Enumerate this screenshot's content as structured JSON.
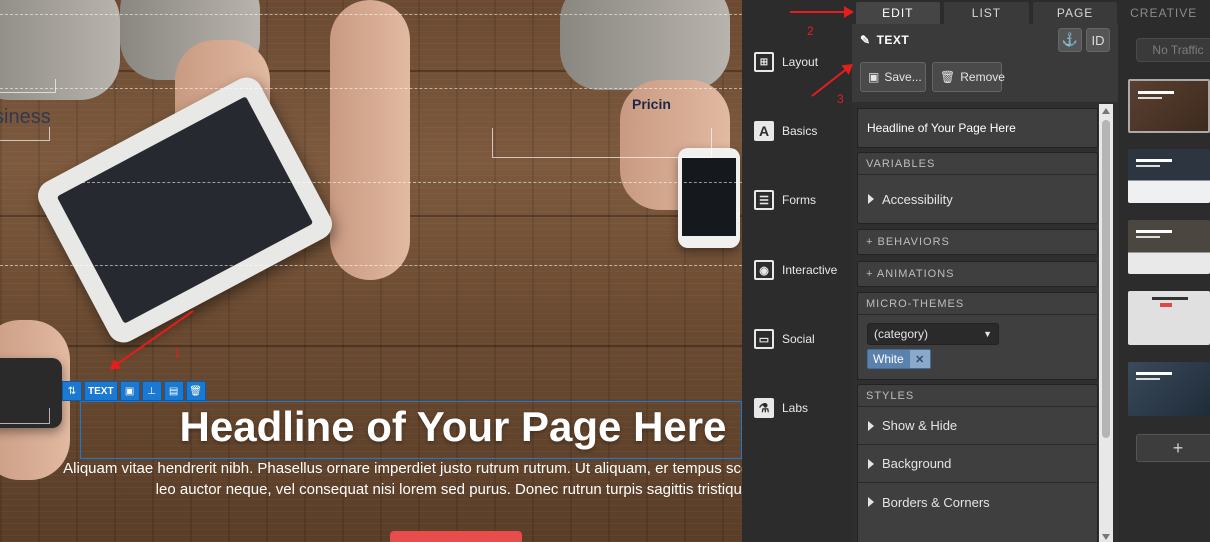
{
  "canvas": {
    "nav_text_left": "siness",
    "nav_pricing": "Pricin",
    "selection_toolbar": {
      "label": "TEXT"
    },
    "headline": "Headline of Your Page Here",
    "body_text": "Aliquam vitae hendrerit nibh. Phasellus ornare imperdiet justo rutrum rutrum. Ut aliquam, er tempus scelerisque, turpis leo auctor neque, vel consequat nisi lorem sed purus. Donec rutrun turpis sagittis tristique."
  },
  "annotations": {
    "n1": "1",
    "n2": "2",
    "n3": "3"
  },
  "tabs": [
    {
      "label": "EDIT",
      "active": true
    },
    {
      "label": "LIST",
      "active": false
    },
    {
      "label": "PAGE",
      "active": false
    },
    {
      "label": "CREATIVE",
      "active": false
    }
  ],
  "categories": [
    {
      "label": "Layout",
      "icon": "layout-icon"
    },
    {
      "label": "Basics",
      "icon": "basics-icon"
    },
    {
      "label": "Forms",
      "icon": "forms-icon"
    },
    {
      "label": "Interactive",
      "icon": "interactive-icon"
    },
    {
      "label": "Social",
      "icon": "social-icon"
    },
    {
      "label": "Labs",
      "icon": "labs-icon"
    }
  ],
  "props": {
    "element_type": "TEXT",
    "id_button": "ID",
    "save_label": "Save...",
    "remove_label": "Remove",
    "element_title": "Headline of Your Page Here",
    "variables": {
      "title": "VARIABLES",
      "items": [
        "Accessibility"
      ]
    },
    "behaviors": "+ BEHAVIORS",
    "animations": "+ ANIMATIONS",
    "micro_themes": {
      "title": "MICRO-THEMES",
      "select_value": "(category)",
      "tag": "White"
    },
    "styles": {
      "title": "STYLES",
      "items": [
        "Show & Hide",
        "Background",
        "Borders & Corners"
      ]
    }
  },
  "thumbs": {
    "no_traffic": "No Traffic",
    "add_label": "+"
  },
  "help": "?",
  "colors": {
    "accent_blue": "#1b79d1",
    "annotation_red": "#e51d1d",
    "tag_blue": "#5a82ad",
    "cta_red": "#ea4b4b"
  }
}
